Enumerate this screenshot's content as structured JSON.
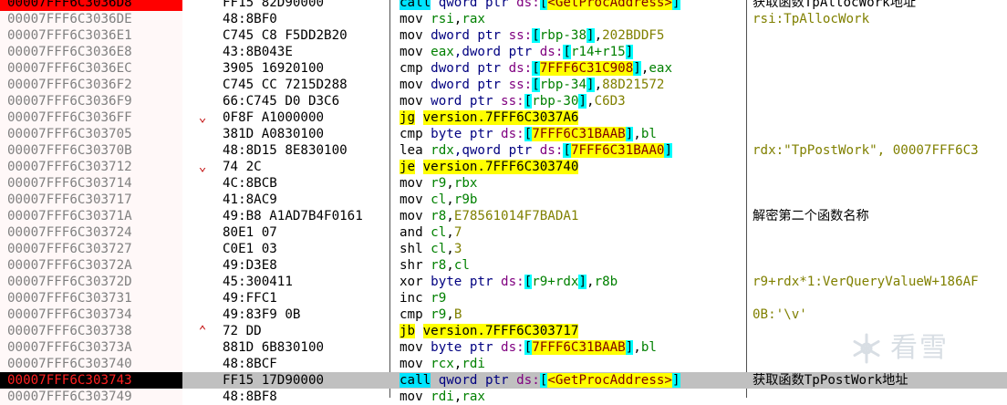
{
  "rows": [
    {
      "addr": "00007FFF6C3036D8",
      "bytes": "FF15 82D90000",
      "cmt": "获取函数TpAllocWork地址"
    },
    {
      "addr": "00007FFF6C3036DE",
      "bytes": "48:8BF0",
      "cmt": "rsi:TpAllocWork"
    },
    {
      "addr": "00007FFF6C3036E1",
      "bytes": "C745 C8 F5DD2B20",
      "cmt": ""
    },
    {
      "addr": "00007FFF6C3036E8",
      "bytes": "43:8B043E",
      "cmt": ""
    },
    {
      "addr": "00007FFF6C3036EC",
      "bytes": "3905 16920100",
      "cmt": ""
    },
    {
      "addr": "00007FFF6C3036F2",
      "bytes": "C745 CC 7215D288",
      "cmt": ""
    },
    {
      "addr": "00007FFF6C3036F9",
      "bytes": "66:C745 D0 D3C6",
      "cmt": ""
    },
    {
      "addr": "00007FFF6C3036FF",
      "bytes": "0F8F A1000000",
      "cmt": ""
    },
    {
      "addr": "00007FFF6C303705",
      "bytes": "381D A0830100",
      "cmt": ""
    },
    {
      "addr": "00007FFF6C30370B",
      "bytes": "48:8D15 8E830100",
      "cmt": "rdx:\"TpPostWork\", 00007FFF6C3"
    },
    {
      "addr": "00007FFF6C303712",
      "bytes": "74 2C",
      "cmt": ""
    },
    {
      "addr": "00007FFF6C303714",
      "bytes": "4C:8BCB",
      "cmt": ""
    },
    {
      "addr": "00007FFF6C303717",
      "bytes": "41:8AC9",
      "cmt": ""
    },
    {
      "addr": "00007FFF6C30371A",
      "bytes": "49:B8 A1AD7B4F0161",
      "cmt": "解密第二个函数名称"
    },
    {
      "addr": "00007FFF6C303724",
      "bytes": "80E1 07",
      "cmt": ""
    },
    {
      "addr": "00007FFF6C303727",
      "bytes": "C0E1 03",
      "cmt": ""
    },
    {
      "addr": "00007FFF6C30372A",
      "bytes": "49:D3E8",
      "cmt": ""
    },
    {
      "addr": "00007FFF6C30372D",
      "bytes": "45:300411",
      "cmt": "r9+rdx*1:VerQueryValueW+186AF"
    },
    {
      "addr": "00007FFF6C303731",
      "bytes": "49:FFC1",
      "cmt": ""
    },
    {
      "addr": "00007FFF6C303734",
      "bytes": "49:83F9 0B",
      "cmt": "0B:'\\v'"
    },
    {
      "addr": "00007FFF6C303738",
      "bytes": "72 DD",
      "cmt": ""
    },
    {
      "addr": "00007FFF6C30373A",
      "bytes": "881D 6B830100",
      "cmt": ""
    },
    {
      "addr": "00007FFF6C303740",
      "bytes": "48:8BCF",
      "cmt": ""
    },
    {
      "addr": "00007FFF6C303743",
      "bytes": "FF15 17D90000",
      "cmt": "获取函数TpPostWork地址"
    },
    {
      "addr": "00007FFF6C303749",
      "bytes": "48:8BF8",
      "cmt": ""
    }
  ],
  "instr": {
    "r0": [
      "call",
      " qword ptr ",
      "ds:",
      "[",
      "<GetProcAddress>",
      "]"
    ],
    "r1": [
      "mov",
      " ",
      "rsi",
      ",",
      "rax"
    ],
    "r2": [
      "mov",
      " dword ptr ",
      "ss:",
      "[",
      "rbp-38",
      "]",
      ",",
      "202BDDF5"
    ],
    "r3": [
      "mov",
      " ",
      "eax",
      ",dword ptr ",
      "ds:",
      "[",
      "r14+r15",
      "]"
    ],
    "r4": [
      "cmp",
      " dword ptr ",
      "ds:",
      "[",
      "7FFF6C31C908",
      "]",
      ",",
      "eax"
    ],
    "r5": [
      "mov",
      " dword ptr ",
      "ss:",
      "[",
      "rbp-34",
      "]",
      ",",
      "88D21572"
    ],
    "r6": [
      "mov",
      " word ptr ",
      "ss:",
      "[",
      "rbp-30",
      "]",
      ",",
      "C6D3"
    ],
    "r7": [
      "jg",
      " ",
      "version.7FFF6C3037A6"
    ],
    "r8": [
      "cmp",
      " byte ptr ",
      "ds:",
      "[",
      "7FFF6C31BAAB",
      "]",
      ",",
      "bl"
    ],
    "r9": [
      "lea",
      " ",
      "rdx",
      ",qword ptr ",
      "ds:",
      "[",
      "7FFF6C31BAA0",
      "]"
    ],
    "r10": [
      "je",
      " ",
      "version.7FFF6C303740"
    ],
    "r11": [
      "mov",
      " ",
      "r9",
      ",",
      "rbx"
    ],
    "r12": [
      "mov",
      " ",
      "cl",
      ",",
      "r9b"
    ],
    "r13": [
      "mov",
      " ",
      "r8",
      ",",
      "E78561014F7BADA1"
    ],
    "r14": [
      "and",
      " ",
      "cl",
      ",",
      "7"
    ],
    "r15": [
      "shl",
      " ",
      "cl",
      ",",
      "3"
    ],
    "r16": [
      "shr",
      " ",
      "r8",
      ",",
      "cl"
    ],
    "r17": [
      "xor",
      " byte ptr ",
      "ds:",
      "[",
      "r9+rdx",
      "]",
      ",",
      "r8b"
    ],
    "r18": [
      "inc",
      " ",
      "r9"
    ],
    "r19": [
      "cmp",
      " ",
      "r9",
      ",",
      "B"
    ],
    "r20": [
      "jb",
      " ",
      "version.7FFF6C303717"
    ],
    "r21": [
      "mov",
      " byte ptr ",
      "ds:",
      "[",
      "7FFF6C31BAAB",
      "]",
      ",",
      "bl"
    ],
    "r22": [
      "mov",
      " ",
      "rcx",
      ",",
      "rdi"
    ],
    "r23": [
      "call",
      " qword ptr ",
      "ds:",
      "[",
      "<GetProcAddress>",
      "]"
    ],
    "r24": [
      "mov",
      " ",
      "rdi",
      ",",
      "rax"
    ]
  },
  "jumps": {
    "r7": "⌄",
    "r10": "⌄",
    "r20": "⌃"
  },
  "watermark": {
    "text": "看雪"
  }
}
